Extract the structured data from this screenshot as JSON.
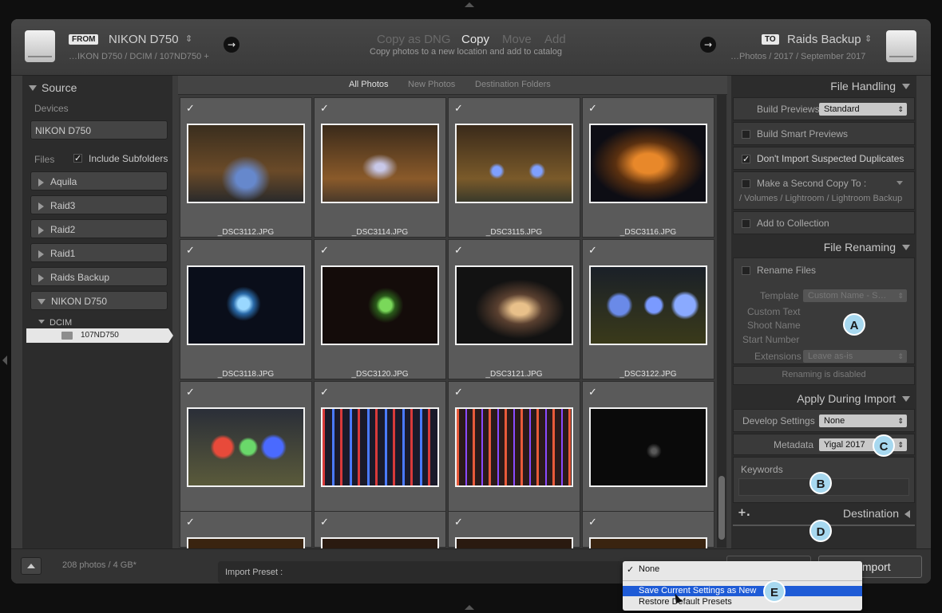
{
  "header": {
    "from_tag": "FROM",
    "source_name": "NIKON D750",
    "source_path": "…IKON D750  / DCIM / 107ND750 +",
    "modes": [
      "Copy as DNG",
      "Copy",
      "Move",
      "Add"
    ],
    "active_mode": "Copy",
    "mode_description": "Copy photos to a new location and add to catalog",
    "to_tag": "TO",
    "dest_name": "Raids Backup",
    "dest_path": "…Photos / 2017 / September 2017"
  },
  "source": {
    "title": "Source",
    "devices_label": "Devices",
    "device": "NIKON D750",
    "files_label": "Files",
    "include_subfolders": "Include Subfolders",
    "volumes": [
      "Aquila",
      "Raid3",
      "Raid2",
      "Raid1",
      "Raids Backup"
    ],
    "expanded_volume": "NIKON D750",
    "folder": "DCIM",
    "subfolder": "107ND750"
  },
  "grid": {
    "tabs": [
      "All Photos",
      "New Photos",
      "Destination Folders"
    ],
    "active_tab": "All Photos",
    "rows": [
      [
        "_DSC3112.JPG",
        "_DSC3114.JPG",
        "_DSC3115.JPG",
        "_DSC3116.JPG"
      ],
      [
        "_DSC3118.JPG",
        "_DSC3120.JPG",
        "_DSC3121.JPG",
        "_DSC3122.JPG"
      ],
      [
        "",
        "",
        "",
        ""
      ]
    ]
  },
  "file_handling": {
    "title": "File Handling",
    "build_previews_label": "Build Previews",
    "build_previews_value": "Standard",
    "smart_previews": "Build Smart Previews",
    "dont_import_dupes": "Don't Import Suspected Duplicates",
    "second_copy": "Make a Second Copy To :",
    "second_copy_path": "/ Volumes / Lightroom / Lightroom Backup",
    "add_to_collection": "Add to Collection"
  },
  "file_renaming": {
    "title": "File Renaming",
    "rename_files": "Rename Files",
    "template_label": "Template",
    "template_value": "Custom Name - S…",
    "custom_text": "Custom Text",
    "shoot_name": "Shoot Name",
    "start_number": "Start Number",
    "extensions_label": "Extensions",
    "extensions_value": "Leave as-is",
    "status": "Renaming is disabled"
  },
  "apply_during_import": {
    "title": "Apply During Import",
    "develop_label": "Develop Settings",
    "develop_value": "None",
    "metadata_label": "Metadata",
    "metadata_value": "Yigal 2017",
    "keywords_label": "Keywords"
  },
  "destination": {
    "title": "Destination",
    "plus": "+."
  },
  "footer": {
    "count": "208 photos / 4 GB*",
    "preset_label": "Import Preset :",
    "import_button": "Import",
    "cancel_button": ""
  },
  "preset_menu": {
    "items": [
      "None",
      "Save Current Settings as New",
      "Restore Default Presets"
    ],
    "checked_item": "None",
    "highlighted_item": "Save Current Settings as New"
  },
  "callouts": {
    "a": "A",
    "b": "B",
    "c": "C",
    "d": "D",
    "e": "E"
  },
  "colors": {
    "accent_highlight": "#1e5bd6",
    "callout": "#a7d8ef"
  }
}
